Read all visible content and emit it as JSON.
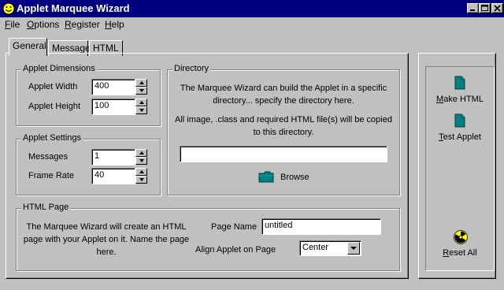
{
  "window": {
    "title": "Applet Marquee Wizard"
  },
  "menu": {
    "items": [
      "File",
      "Options",
      "Register",
      "Help"
    ]
  },
  "tabs": [
    "General",
    "Message",
    "HTML"
  ],
  "applet_dimensions": {
    "label": "Applet Dimensions",
    "width_label": "Applet Width",
    "width_value": "400",
    "height_label": "Applet Height",
    "height_value": "100"
  },
  "applet_settings": {
    "label": "Applet Settings",
    "messages_label": "Messages",
    "messages_value": "1",
    "frame_rate_label": "Frame Rate",
    "frame_rate_value": "40"
  },
  "directory": {
    "label": "Directory",
    "description": "The Marquee Wizard can build the Applet in a specific directory... specify the directory here.",
    "copy_note": "All image, .class and required HTML file(s) will be copied to this directory.",
    "path_value": "",
    "browse_label": "Browse"
  },
  "html_page": {
    "label": "HTML Page",
    "description": "The Marquee Wizard will create an HTML page with your Applet on it. Name the page here.",
    "page_name_label": "Page Name",
    "page_name_value": "untitled",
    "align_label": "Align Applet on Page",
    "align_value": "Center"
  },
  "actions": {
    "make_html": "Make HTML",
    "test_applet": "Test Applet",
    "reset_all": "Reset All"
  },
  "icons": {
    "app": "smiley-icon",
    "make_html": "document-icon",
    "test_applet": "document-icon",
    "browse": "folder-icon",
    "reset_all": "radiation-icon"
  },
  "colors": {
    "titlebar": "#000080",
    "face": "#c0c0c0",
    "icon_teal": "#008080",
    "smiley_yellow": "#ffff00"
  }
}
